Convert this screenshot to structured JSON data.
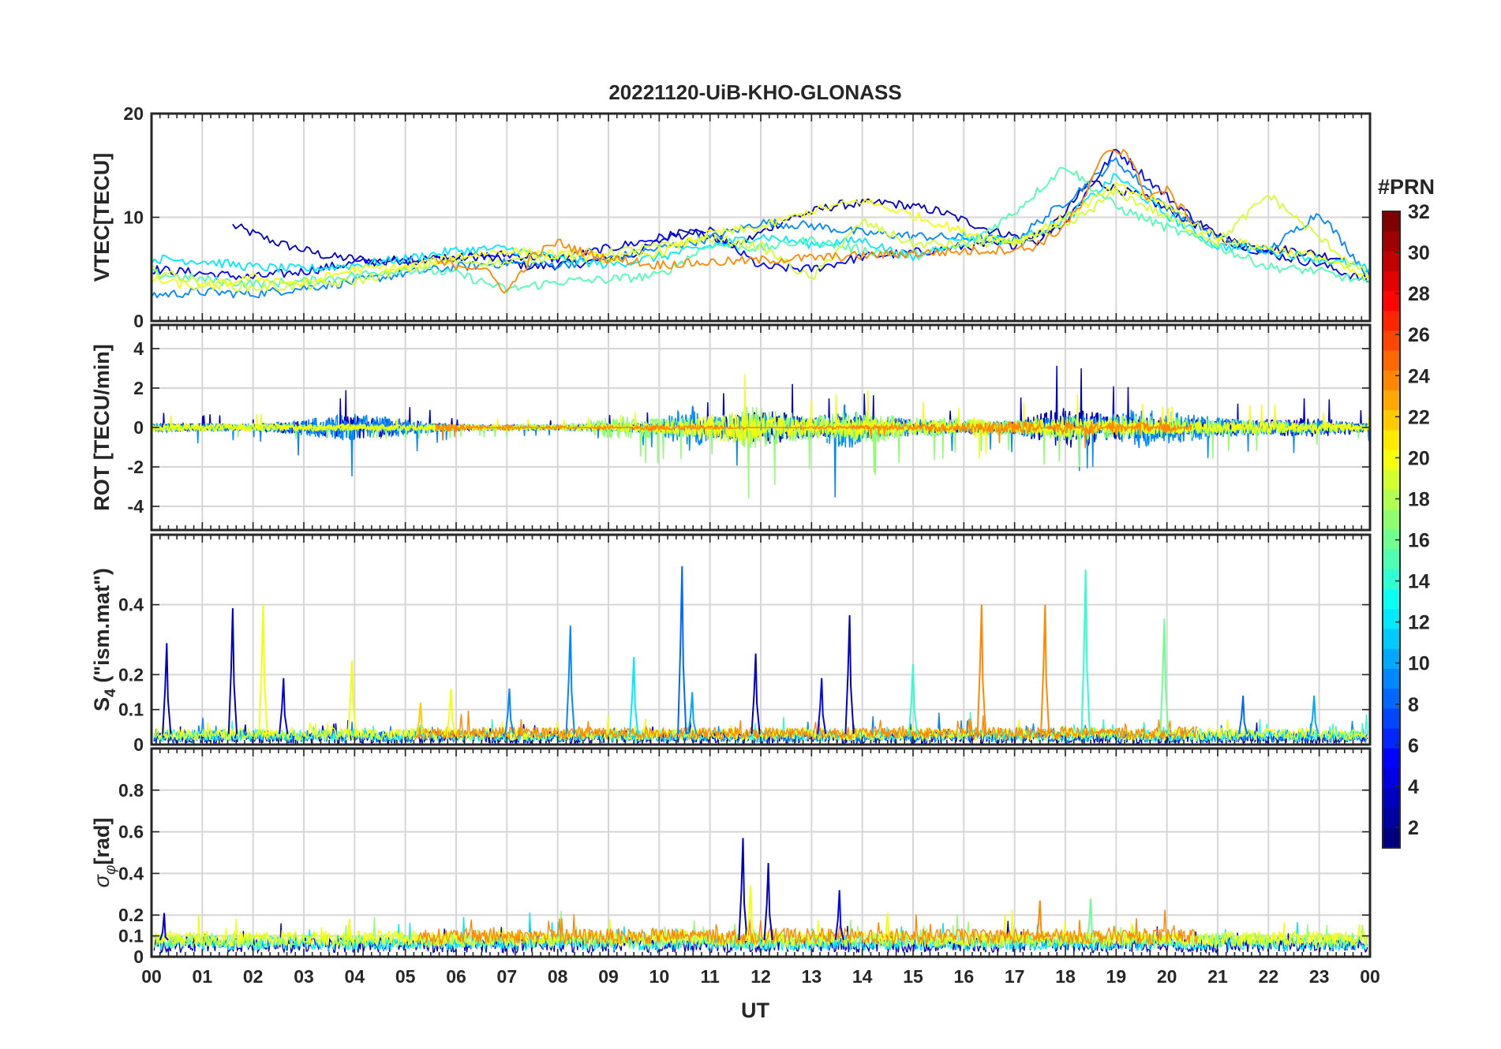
{
  "chart_data": {
    "type": "line",
    "title": "20221120-UiB-KHO-GLONASS",
    "xlabel": "UT",
    "x_tick_labels": [
      "00",
      "01",
      "02",
      "03",
      "04",
      "05",
      "06",
      "07",
      "08",
      "09",
      "10",
      "11",
      "12",
      "13",
      "14",
      "15",
      "16",
      "17",
      "18",
      "19",
      "20",
      "21",
      "22",
      "23",
      "00"
    ],
    "xlim_hours": [
      0,
      24
    ],
    "grid": true,
    "colormap": "jet",
    "colorbar": {
      "label": "#PRN",
      "tick_labels": [
        "2",
        "4",
        "6",
        "8",
        "10",
        "12",
        "14",
        "16",
        "18",
        "20",
        "22",
        "24",
        "26",
        "28",
        "30",
        "32"
      ],
      "range": [
        1,
        32
      ],
      "position": "right"
    },
    "panels": [
      {
        "id": "vtec",
        "ylabel": "VTEC[TECU]",
        "ylim": [
          0,
          20
        ],
        "y_ticks": [
          0,
          10,
          20
        ],
        "y_tick_labels": [
          "0",
          "10",
          "20"
        ],
        "series": [
          {
            "prn": 3,
            "x": [
              1.6,
              2.5,
              3.5,
              4.5,
              5.5,
              6.5,
              7.5,
              8.5,
              9.5,
              10.5,
              11.5,
              12.5,
              13.5,
              14.5,
              15.5,
              16.5,
              17.5,
              18.5,
              19.5,
              20.5,
              21.5,
              22.5,
              23.5
            ],
            "y": [
              9.2,
              7.5,
              6.2,
              5.8,
              6.0,
              6.2,
              5.2,
              5.6,
              6.4,
              9.0,
              7.2,
              9.8,
              11.2,
              11.4,
              10.6,
              8.8,
              7.6,
              13.5,
              12.0,
              9.5,
              7.2,
              6.8,
              6.0
            ]
          },
          {
            "prn": 5,
            "x": [
              0,
              1,
              2,
              3,
              4,
              5,
              6,
              7,
              8,
              9,
              10,
              11,
              12,
              13,
              14,
              15,
              16,
              17,
              18,
              19,
              20,
              21,
              22,
              23,
              24
            ],
            "y": [
              5.0,
              4.6,
              4.2,
              4.8,
              5.6,
              5.8,
              6.2,
              6.4,
              6.0,
              7.0,
              8.0,
              8.6,
              5.2,
              5.0,
              6.2,
              6.6,
              7.2,
              7.4,
              9.5,
              16.5,
              12.0,
              8.0,
              6.5,
              5.5,
              3.8
            ]
          },
          {
            "prn": 9,
            "x": [
              0,
              1,
              2,
              3,
              4,
              5,
              6,
              7,
              8,
              9,
              10,
              11,
              12,
              13,
              14,
              15,
              16,
              17,
              18,
              19,
              20,
              21,
              22,
              23,
              24
            ],
            "y": [
              2.5,
              2.8,
              2.6,
              3.2,
              3.8,
              4.6,
              5.2,
              5.6,
              5.4,
              6.0,
              7.0,
              8.0,
              9.5,
              9.2,
              8.5,
              8.2,
              8.0,
              7.8,
              11.5,
              15.5,
              11.0,
              8.0,
              6.8,
              10.5,
              4.2
            ]
          },
          {
            "prn": 12,
            "x": [
              0,
              1,
              2,
              3,
              4,
              5,
              6,
              7,
              8,
              9,
              10,
              11,
              12,
              13,
              14,
              15,
              16,
              17,
              18,
              19,
              20,
              21,
              22,
              23,
              24
            ],
            "y": [
              6.0,
              5.8,
              5.2,
              5.0,
              5.4,
              6.0,
              6.8,
              7.0,
              6.0,
              5.4,
              6.2,
              7.2,
              8.2,
              7.4,
              7.8,
              6.0,
              8.2,
              7.6,
              9.8,
              14.0,
              10.2,
              7.2,
              6.8,
              6.0,
              5.0
            ]
          },
          {
            "prn": 15,
            "x": [
              0,
              1,
              2,
              3,
              4,
              5,
              6,
              7,
              8,
              9,
              10,
              11,
              12,
              13,
              14,
              15,
              16,
              17,
              18,
              19,
              20,
              21,
              22,
              23,
              24
            ],
            "y": [
              4.6,
              4.0,
              3.6,
              3.8,
              4.4,
              5.0,
              4.6,
              3.0,
              3.8,
              4.0,
              4.4,
              7.4,
              7.0,
              7.8,
              6.8,
              6.4,
              7.2,
              10.5,
              15.0,
              11.0,
              9.0,
              7.2,
              5.2,
              4.8,
              3.6
            ]
          },
          {
            "prn": 19,
            "x": [
              0,
              1,
              2,
              3,
              4,
              5,
              6,
              7,
              8,
              9,
              10,
              11,
              12,
              13,
              14,
              15,
              16,
              17,
              18,
              19,
              20,
              21,
              22,
              23,
              24
            ],
            "y": [
              5.0,
              3.6,
              3.2,
              3.4,
              3.8,
              5.0,
              5.8,
              5.6,
              6.4,
              6.6,
              7.2,
              8.0,
              7.2,
              4.0,
              9.6,
              7.4,
              7.4,
              7.6,
              9.0,
              12.5,
              10.0,
              7.6,
              12.2,
              8.0,
              4.2
            ]
          },
          {
            "prn": 20,
            "x": [
              0,
              1,
              2,
              3,
              4,
              5,
              6,
              7,
              8,
              9,
              10,
              11,
              12,
              13,
              14,
              15,
              16,
              17,
              18,
              19,
              20,
              21,
              22,
              23,
              24
            ],
            "y": [
              4.0,
              3.2,
              4.2,
              3.6,
              5.0,
              5.2,
              6.2,
              6.8,
              6.4,
              6.0,
              6.6,
              8.4,
              9.0,
              10.6,
              11.6,
              10.2,
              8.6,
              7.6,
              10.0,
              13.0,
              11.2,
              8.0,
              7.0,
              6.2,
              4.0
            ]
          },
          {
            "prn": 24,
            "x": [
              5.6,
              6.5,
              7.0,
              7.5,
              8.0,
              8.5,
              9.0,
              9.5,
              9.8,
              17.3,
              17.8,
              18.3,
              18.8,
              19.2,
              19.6,
              20.0,
              20.5
            ],
            "y": [
              5.6,
              5.2,
              2.8,
              6.2,
              7.6,
              6.6,
              6.0,
              5.8,
              5.4,
              7.0,
              8.4,
              11.0,
              16.5,
              16.4,
              12.0,
              12.6,
              9.6
            ]
          }
        ]
      },
      {
        "id": "rot",
        "ylabel": "ROT [TECU/min]",
        "ylim": [
          -5.2,
          5.2
        ],
        "y_ticks": [
          -4,
          -2,
          0,
          2,
          4
        ],
        "y_tick_labels": [
          "-4",
          "-2",
          "0",
          "2",
          "4"
        ],
        "series_note": "noisy traces around 0; envelope below in data units",
        "series": [
          {
            "prn": 3,
            "x": [
              0,
              2,
              4,
              6,
              8,
              10,
              11,
              12,
              13,
              14,
              15,
              16,
              17,
              18,
              19,
              20,
              21,
              22,
              23,
              24
            ],
            "y": [
              0.9,
              0.5,
              2.2,
              0.5,
              0.4,
              0.9,
              1.6,
              3.4,
              1.8,
              2.2,
              1.4,
              1.0,
              1.2,
              4.0,
              2.4,
              1.8,
              1.4,
              1.6,
              1.8,
              0.8
            ]
          },
          {
            "prn": 9,
            "x": [
              0,
              2,
              4,
              6,
              8,
              10,
              10.6,
              11,
              12,
              13,
              13.7,
              14,
              15,
              16,
              17,
              18,
              19,
              19.4,
              20,
              21,
              22,
              23,
              24
            ],
            "y": [
              -1.0,
              -0.6,
              -2.6,
              -0.5,
              -0.4,
              -1.2,
              -4.6,
              -2.0,
              -2.4,
              -2.0,
              -4.6,
              -2.4,
              -1.6,
              -1.2,
              -1.4,
              -2.2,
              -2.6,
              -4.0,
              -3.2,
              -1.8,
              -1.4,
              -1.6,
              -0.8
            ]
          },
          {
            "prn": 17,
            "x": [
              0,
              4,
              8,
              9.1,
              11,
              11.8,
              12,
              13,
              14,
              15,
              16,
              17,
              18,
              18.4,
              19,
              20,
              21,
              22,
              23,
              24
            ],
            "y": [
              -0.6,
              -0.6,
              -0.5,
              -2.1,
              -1.6,
              -4.2,
              -3.6,
              -2.2,
              -3.2,
              -1.8,
              -1.6,
              -1.4,
              -2.4,
              -2.2,
              -2.4,
              -2.0,
              -1.6,
              -1.2,
              -1.0,
              -0.6
            ]
          },
          {
            "prn": 20,
            "x": [
              0,
              4,
              8,
              10,
              11,
              11.9,
              12,
              13,
              14,
              15,
              16,
              16.2,
              17,
              18,
              19,
              20,
              21,
              22,
              23,
              24
            ],
            "y": [
              0.8,
              0.6,
              0.4,
              1.0,
              2.4,
              3.6,
              2.2,
              1.6,
              2.2,
              1.4,
              1.0,
              -2.5,
              1.2,
              1.8,
              1.4,
              1.2,
              1.0,
              1.2,
              1.0,
              0.6
            ]
          },
          {
            "prn": 24,
            "x": [
              5.6,
              6.5,
              7.0,
              8.0,
              9.0,
              9.8,
              17.3,
              18.0,
              18.5,
              19.0,
              19.5,
              20.0,
              20.5
            ],
            "y": [
              -0.8,
              -0.4,
              0.5,
              -0.4,
              0.4,
              -0.6,
              1.2,
              -1.6,
              2.0,
              -2.0,
              1.6,
              -1.4,
              0.8
            ]
          }
        ]
      },
      {
        "id": "s4",
        "ylabel": "S4 (\"ism.mat\")",
        "ylim": [
          0,
          0.6
        ],
        "y_ticks": [
          0,
          0.1,
          0.2,
          0.4
        ],
        "y_tick_labels": [
          "0",
          "0.1",
          "0.2",
          "0.4"
        ],
        "series_note": "baseline ~0.01-0.05 with isolated spikes",
        "spikes": [
          {
            "prn": 3,
            "x": 0.3,
            "y": 0.29
          },
          {
            "prn": 3,
            "x": 1.6,
            "y": 0.39
          },
          {
            "prn": 20,
            "x": 2.2,
            "y": 0.4
          },
          {
            "prn": 4,
            "x": 2.6,
            "y": 0.19
          },
          {
            "prn": 20,
            "x": 3.95,
            "y": 0.24
          },
          {
            "prn": 22,
            "x": 5.3,
            "y": 0.12
          },
          {
            "prn": 20,
            "x": 5.9,
            "y": 0.16
          },
          {
            "prn": 9,
            "x": 7.05,
            "y": 0.16
          },
          {
            "prn": 9,
            "x": 8.25,
            "y": 0.34
          },
          {
            "prn": 12,
            "x": 9.5,
            "y": 0.25
          },
          {
            "prn": 8,
            "x": 10.45,
            "y": 0.51
          },
          {
            "prn": 10,
            "x": 10.65,
            "y": 0.15
          },
          {
            "prn": 3,
            "x": 11.9,
            "y": 0.26
          },
          {
            "prn": 5,
            "x": 13.2,
            "y": 0.19
          },
          {
            "prn": 3,
            "x": 13.75,
            "y": 0.37
          },
          {
            "prn": 14,
            "x": 15.0,
            "y": 0.23
          },
          {
            "prn": 24,
            "x": 16.35,
            "y": 0.4
          },
          {
            "prn": 24,
            "x": 17.6,
            "y": 0.4
          },
          {
            "prn": 14,
            "x": 18.4,
            "y": 0.5
          },
          {
            "prn": 16,
            "x": 19.95,
            "y": 0.36
          },
          {
            "prn": 8,
            "x": 21.5,
            "y": 0.14
          },
          {
            "prn": 10,
            "x": 22.9,
            "y": 0.14
          }
        ]
      },
      {
        "id": "sigma_phi",
        "ylabel": "σ φ [rad]",
        "ylim": [
          0,
          1.0
        ],
        "y_ticks": [
          0,
          0.1,
          0.2,
          0.4,
          0.6,
          0.8
        ],
        "y_tick_labels": [
          "0",
          "0.1",
          "0.2",
          "0.4",
          "0.6",
          "0.8"
        ],
        "series_note": "baseline ~0.03-0.12 with spikes near 12 UT",
        "spikes": [
          {
            "prn": 3,
            "x": 0.25,
            "y": 0.21
          },
          {
            "prn": 20,
            "x": 3.9,
            "y": 0.18
          },
          {
            "prn": 3,
            "x": 11.65,
            "y": 0.57
          },
          {
            "prn": 20,
            "x": 11.8,
            "y": 0.34
          },
          {
            "prn": 3,
            "x": 12.15,
            "y": 0.45
          },
          {
            "prn": 5,
            "x": 13.55,
            "y": 0.32
          },
          {
            "prn": 20,
            "x": 14.5,
            "y": 0.21
          },
          {
            "prn": 24,
            "x": 17.5,
            "y": 0.27
          },
          {
            "prn": 16,
            "x": 18.5,
            "y": 0.28
          }
        ]
      }
    ]
  }
}
